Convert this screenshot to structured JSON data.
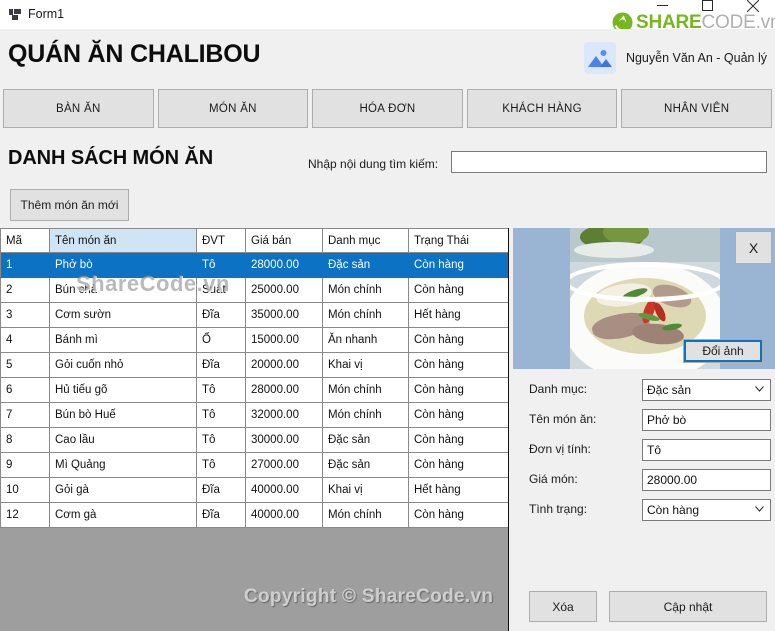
{
  "window": {
    "title": "Form1",
    "icon": "form-icon",
    "minimize_label": "—",
    "maximize_label": "□",
    "close_label": "✕"
  },
  "watermark": {
    "logo_green": "SHARE",
    "logo_gray": "CODE.vn",
    "logo_green_color": "#76b71f",
    "logo_gray_color": "#b0b0b0",
    "table_text": "ShareCode.vn",
    "bottom_text": "Copyright © ShareCode.vn"
  },
  "header": {
    "brand": "QUÁN ĂN CHALIBOU",
    "user_name": "Nguyễn Văn An - Quản lý",
    "avatar_icon": "image-placeholder-icon"
  },
  "nav": {
    "items": [
      {
        "label": "BÀN ĂN"
      },
      {
        "label": "MÓN ĂN"
      },
      {
        "label": "HÓA ĐƠN"
      },
      {
        "label": "KHÁCH HÀNG"
      },
      {
        "label": "NHÂN VIÊN"
      }
    ]
  },
  "main": {
    "list_title": "DANH SÁCH MÓN ĂN",
    "search_label": "Nhập nội dung tìm kiếm:",
    "search_value": "",
    "search_placeholder": "",
    "add_button": "Thêm món ăn mới"
  },
  "table": {
    "columns": [
      "Mã",
      "Tên món ăn",
      "ĐVT",
      "Giá bán",
      "Danh mục",
      "Trạng Thái"
    ],
    "selected_column_index": 1,
    "selected_row_index": 0,
    "selection_color": "#0b72c4",
    "rows": [
      {
        "ma": "1",
        "ten": "Phở bò",
        "dvt": "Tô",
        "gia": "28000.00",
        "danhmuc": "Đặc sản",
        "trangthai": "Còn hàng"
      },
      {
        "ma": "2",
        "ten": "Bún chả",
        "dvt": "Suất",
        "gia": "25000.00",
        "danhmuc": "Món chính",
        "trangthai": "Còn hàng"
      },
      {
        "ma": "3",
        "ten": "Cơm sườn",
        "dvt": "Đĩa",
        "gia": "35000.00",
        "danhmuc": "Món chính",
        "trangthai": "Hết hàng"
      },
      {
        "ma": "4",
        "ten": "Bánh mì",
        "dvt": "Ổ",
        "gia": "15000.00",
        "danhmuc": "Ăn nhanh",
        "trangthai": "Còn hàng"
      },
      {
        "ma": "5",
        "ten": "Gỏi cuốn nhỏ",
        "dvt": "Đĩa",
        "gia": "20000.00",
        "danhmuc": "Khai vị",
        "trangthai": "Còn hàng"
      },
      {
        "ma": "6",
        "ten": "Hủ tiếu gõ",
        "dvt": "Tô",
        "gia": "28000.00",
        "danhmuc": "Món chính",
        "trangthai": "Còn hàng"
      },
      {
        "ma": "7",
        "ten": "Bún bò Huế",
        "dvt": "Tô",
        "gia": "32000.00",
        "danhmuc": "Món chính",
        "trangthai": "Còn hàng"
      },
      {
        "ma": "8",
        "ten": "Cao lầu",
        "dvt": "Tô",
        "gia": "30000.00",
        "danhmuc": "Đặc sản",
        "trangthai": "Còn hàng"
      },
      {
        "ma": "9",
        "ten": "Mì Quảng",
        "dvt": "Tô",
        "gia": "27000.00",
        "danhmuc": "Đặc sản",
        "trangthai": "Còn hàng"
      },
      {
        "ma": "10",
        "ten": "Gỏi gà",
        "dvt": "Đĩa",
        "gia": "40000.00",
        "danhmuc": "Khai vị",
        "trangthai": "Hết hàng"
      },
      {
        "ma": "12",
        "ten": "Cơm gà",
        "dvt": "Đĩa",
        "gia": "40000.00",
        "danhmuc": "Món chính",
        "trangthai": "Còn hàng"
      }
    ]
  },
  "detail": {
    "photo_alt": "dish-photo-pho-bo",
    "photo_panel_color": "#9ab4d4",
    "close_image_label": "X",
    "change_image_label": "Đổi ảnh",
    "fields": [
      {
        "label": "Danh mục:",
        "value": "Đặc sản",
        "type": "combo"
      },
      {
        "label": "Tên món ăn:",
        "value": "Phở bò",
        "type": "text"
      },
      {
        "label": "Đơn vị tính:",
        "value": "Tô",
        "type": "text"
      },
      {
        "label": "Giá món:",
        "value": "28000.00",
        "type": "text"
      },
      {
        "label": "Tình trạng:",
        "value": "Còn hàng",
        "type": "combo"
      }
    ],
    "delete_button": "Xóa",
    "update_button": "Cập nhật"
  }
}
